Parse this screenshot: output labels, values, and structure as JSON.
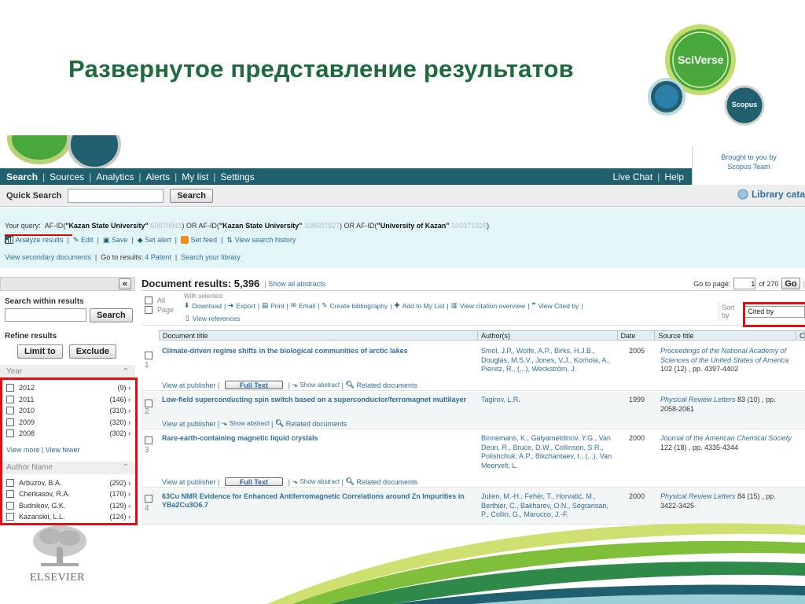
{
  "slide_title": "Развернутое представление результатов",
  "logo": {
    "main": "SciVerse",
    "sub": "Scopus"
  },
  "brought_by": "Brought to you by",
  "brought_team": "Scopus Team",
  "nav": {
    "items": [
      "Search",
      "Sources",
      "Analytics",
      "Alerts",
      "My list",
      "Settings"
    ],
    "right": [
      "Live Chat",
      "Help"
    ]
  },
  "quick_search": {
    "label": "Quick Search",
    "value": "",
    "button": "Search",
    "library": "Library cata"
  },
  "query": {
    "prefix": "Your query:",
    "p1": "AF-ID(",
    "p1b": "\"Kazan State University\"",
    "p1g": "60070941",
    "or1": ") OR AF-ID(",
    "p2b": "\"Kazan State University\"",
    "p2g": "108507927",
    "or2": ") OR AF-ID(",
    "p3b": "\"University of Kazan\"",
    "p3g": "100371925",
    "end": ")"
  },
  "query_actions": [
    "Analyze results",
    "Edit",
    "Save",
    "Set alert",
    "Set feed",
    "View search history"
  ],
  "query_links": {
    "secondary": "View secondary documents",
    "goto": "Go to results:",
    "patent": "4 Patent",
    "library": "Search your library"
  },
  "left_panel": {
    "collapse": "«",
    "search_within": "Search within results",
    "search_btn": "Search",
    "refine": "Refine results",
    "limit": "Limit to",
    "exclude": "Exclude",
    "year_title": "Year",
    "years": [
      {
        "label": "2012",
        "count": "(9)"
      },
      {
        "label": "2011",
        "count": "(146)"
      },
      {
        "label": "2010",
        "count": "(310)"
      },
      {
        "label": "2009",
        "count": "(320)"
      },
      {
        "label": "2008",
        "count": "(302)"
      }
    ],
    "view_more": "View more",
    "view_fewer": "View fewer",
    "author_title": "Author Name",
    "authors": [
      {
        "label": "Arbuzov, B.A.",
        "count": "(292)"
      },
      {
        "label": "Cherkasov, R.A.",
        "count": "(170)"
      },
      {
        "label": "Budnikov, G.K.",
        "count": "(129)"
      },
      {
        "label": "Kazanskii, L.L.",
        "count": "(124)"
      }
    ]
  },
  "results": {
    "title": "Document results: 5,396",
    "show_abstracts": "Show all abstracts",
    "goto_page": "Go to page:",
    "page": "1",
    "of": "of 270",
    "go": "Go",
    "all": "All",
    "page_lbl": "Page",
    "with_selected": "With selected:",
    "actions": [
      "Download",
      "Export",
      "Print",
      "Email",
      "Create bibliography",
      "Add to My List",
      "View citation overview",
      "View Cited by"
    ],
    "view_refs": "View references",
    "sort_by": "Sort by",
    "sort_value": "Cited by",
    "cols": [
      "Document title",
      "Author(s)",
      "Date",
      "Source title",
      "C"
    ],
    "view_publisher": "View at publisher",
    "full_text": "Full Text",
    "show_abstract": "Show abstract",
    "related": "Related documents",
    "rows": [
      {
        "num": "1",
        "title": "Climate-driven regime shifts in the biological communities of arctic lakes",
        "authors": "Smol, J.P., Wolfe, A.P., Birks, H.J.B., Douglas, M.S.V., Jones, V.J., Korhola, A., Pienitz, R., (...), Weckström, J.",
        "date": "2005",
        "source": "Proceedings of the National Academy of Sciences of the United States of America",
        "detail": " 102 (12) , pp. 4397-4402"
      },
      {
        "num": "2",
        "title": "Low-field superconducting spin switch based on a superconductor/ferromagnet multilayer",
        "authors": "Tagirov, L.R.",
        "date": "1999",
        "source": "Physical Review Letters",
        "detail": " 83 (10) , pp. 2058-2061"
      },
      {
        "num": "3",
        "title": "Rare-earth-containing magnetic liquid crystals",
        "authors": "Binnemans, K., Galyametdinov, Y.G., Van Deun, R., Bruce, D.W., Collinson, S.R., Polishchuk, A.P., Bikchantaev, I., (...), Van Meervelt, L.",
        "date": "2000",
        "source": "Journal of the American Chemical Society",
        "detail": " 122 (18) , pp. 4335-4344"
      },
      {
        "num": "4",
        "title": "63Cu NMR Evidence for Enhanced Antiferromagnetic Correlations around Zn Impurities in YBa2Cu3O6.7",
        "authors": "Julien, M.-H., Fehér, T., Horvatić, M., Berthier, C., Bakharev, O.N., Ségransan, P., Collin, G., Marucco, J.-F.",
        "date": "2000",
        "source": "Physical Review Letters",
        "detail": " 84 (15) , pp. 3422-3425"
      }
    ]
  },
  "publisher": "ELSEVIER",
  "colors": {
    "title_green": "#1e6a3c",
    "nav_teal": "#1f5f6e",
    "query_bg": "#e2f5f7",
    "highlight_red": "#e01010",
    "link_blue": "#2f6e9e"
  }
}
